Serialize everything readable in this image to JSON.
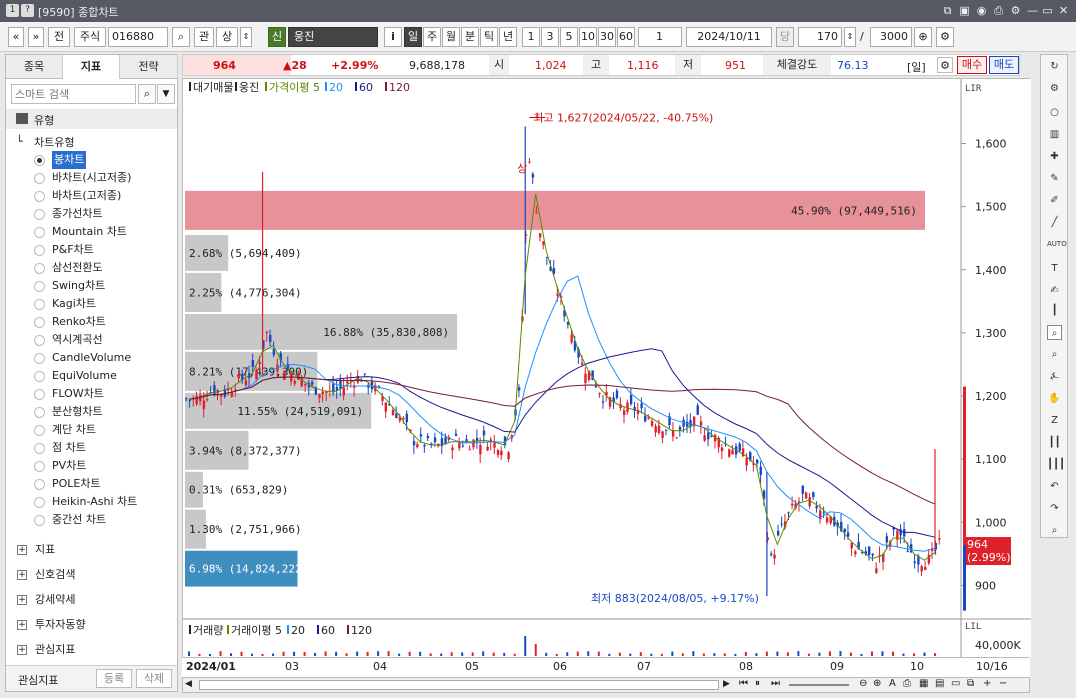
{
  "window": {
    "title": "[9590] 종합차트",
    "badges": [
      "1",
      "?"
    ]
  },
  "toolbar": {
    "nav_prev": "«",
    "nav_down": "»",
    "prev_label": "전",
    "market": "주식",
    "code": "016880",
    "search": "⌕",
    "watch": "관",
    "updown": "상",
    "credit": "신",
    "name": "웅진",
    "info": "i",
    "periods": [
      "일",
      "주",
      "월",
      "분",
      "틱",
      "년"
    ],
    "intervals": [
      "1",
      "3",
      "5",
      "10",
      "30",
      "60"
    ],
    "interval_value": "1",
    "date": "2024/10/11",
    "date_unit": "당",
    "count": "170",
    "slash": "/",
    "max": "3000"
  },
  "left": {
    "tabs": [
      "종목",
      "지표",
      "전략"
    ],
    "search_placeholder": "스마트 검색",
    "root": "유형",
    "section": "차트유형",
    "types": [
      "봉차트",
      "바차트(시고저종)",
      "바차트(고저종)",
      "종가선차트",
      "Mountain 차트",
      "P&F차트",
      "삼선전환도",
      "Swing차트",
      "Kagi차트",
      "Renko차트",
      "역시계곡선",
      "CandleVolume",
      "EquiVolume",
      "FLOW차트",
      "분산형차트",
      "계단 차트",
      "점 차트",
      "PV차트",
      "POLE차트",
      "Heikin-Ashi 차트",
      "중간선 차트"
    ],
    "groups": [
      "지표",
      "신호검색",
      "강세약세",
      "투자자동향",
      "관심지표"
    ],
    "footer_label": "관심지표",
    "register": "등록",
    "delete": "삭제"
  },
  "quote": {
    "price": "964",
    "change": "▲28",
    "rate": "+2.99%",
    "volume": "9,688,178",
    "open_label": "시",
    "open": "1,024",
    "high_label": "고",
    "high": "1,116",
    "low_label": "저",
    "low": "951",
    "strength_label": "체결강도",
    "strength": "76.13",
    "unit": "[일]",
    "buy": "매수",
    "sell": "매도"
  },
  "legend": {
    "top": [
      "대기매물",
      "웅진",
      "가격이평 5",
      "20",
      "60",
      "120"
    ],
    "vol": [
      "거래량",
      "거래이평 5",
      "20",
      "60",
      "120"
    ]
  },
  "annotations": {
    "high": "최고 1,627(2024/05/22, -40.75%)",
    "low": "최저 883(2024/08/05, +9.17%)",
    "arrow_low": "⟶",
    "arrow_high": "⟵",
    "up": "상",
    "current_price": "964",
    "current_rate": "(2.99%)",
    "lir": "LIR",
    "lil": "LIL"
  },
  "chart_data": {
    "type": "bar",
    "y_ticks": [
      "1,600",
      "1,500",
      "1,400",
      "1,300",
      "1,200",
      "1,100",
      "1,000",
      "900"
    ],
    "y_range": [
      850,
      1680
    ],
    "vol_tick": "40,000K",
    "x_ticks": [
      "2024/01",
      "03",
      "04",
      "05",
      "06",
      "07",
      "08",
      "09",
      "10"
    ],
    "x_end": "10/16",
    "volume_profile": [
      {
        "label": "45.90% (97,449,516)",
        "low": 1460,
        "high": 1525,
        "pct": 45.9,
        "highlight": "max"
      },
      {
        "label": "2.68% (5,694,409)",
        "low": 1395,
        "high": 1455,
        "pct": 2.68
      },
      {
        "label": "2.25% (4,776,304)",
        "low": 1330,
        "high": 1395,
        "pct": 2.25
      },
      {
        "label": "16.88% (35,830,808)",
        "low": 1270,
        "high": 1330,
        "pct": 16.88
      },
      {
        "label": "8.21% (17,439,300)",
        "low": 1205,
        "high": 1270,
        "pct": 8.21
      },
      {
        "label": "11.55% (24,519,091)",
        "low": 1145,
        "high": 1205,
        "pct": 11.55
      },
      {
        "label": "3.94% (8,372,377)",
        "low": 1080,
        "high": 1145,
        "pct": 3.94
      },
      {
        "label": "0.31% (653,829)",
        "low": 1020,
        "high": 1080,
        "pct": 0.31
      },
      {
        "label": "1.30% (2,751,966)",
        "low": 955,
        "high": 1020,
        "pct": 1.3
      },
      {
        "label": "6.98% (14,824,222)",
        "low": 895,
        "high": 955,
        "pct": 6.98,
        "highlight": "current"
      }
    ],
    "high_point": {
      "date": "2024/05/22",
      "price": 1627
    },
    "low_point": {
      "date": "2024/08/05",
      "price": 883
    },
    "last_price": 964,
    "trend_closes": [
      1195,
      1200,
      1210,
      1205,
      1220,
      1230,
      1240,
      1300,
      1260,
      1240,
      1230,
      1215,
      1210,
      1205,
      1210,
      1225,
      1230,
      1215,
      1200,
      1180,
      1160,
      1130,
      1125,
      1120,
      1125,
      1130,
      1125,
      1130,
      1130,
      1125,
      1120,
      1200,
      1580,
      1460,
      1400,
      1350,
      1300,
      1250,
      1230,
      1200,
      1190,
      1180,
      1180,
      1170,
      1160,
      1150,
      1140,
      1150,
      1160,
      1140,
      1130,
      1120,
      1110,
      1100,
      1080,
      940,
      990,
      1020,
      1040,
      1030,
      1020,
      1000,
      980,
      960,
      950,
      935,
      960,
      990,
      960,
      940,
      940,
      964
    ],
    "series": [
      {
        "name": "5",
        "color": "#5a8a00"
      },
      {
        "name": "20",
        "color": "#1e90ff"
      },
      {
        "name": "60",
        "color": "#1a1a8c"
      },
      {
        "name": "120",
        "color": "#7a1a3a"
      }
    ]
  },
  "colors": {
    "up": "#e0202a",
    "down": "#1747c4",
    "accent": "#2a6fcf"
  }
}
